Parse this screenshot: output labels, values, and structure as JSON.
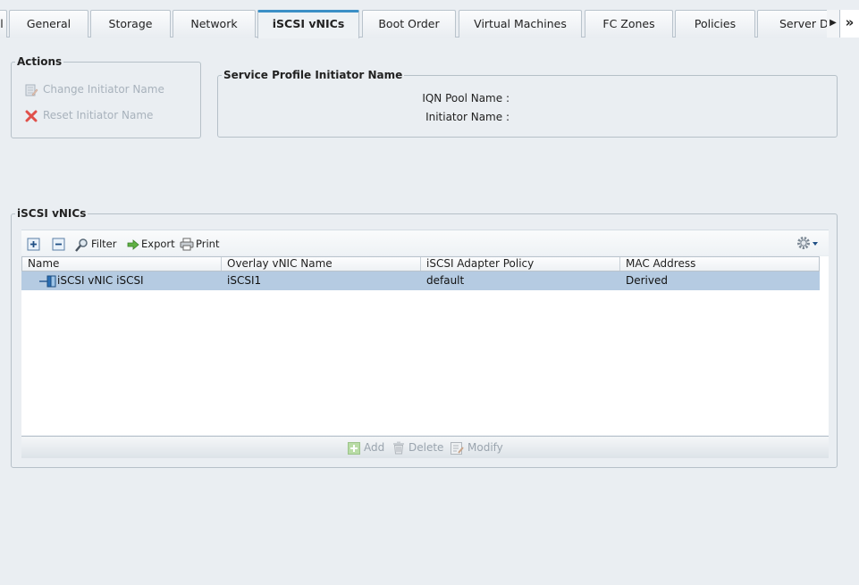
{
  "tabs": [
    {
      "label": "l"
    },
    {
      "label": "General"
    },
    {
      "label": "Storage"
    },
    {
      "label": "Network"
    },
    {
      "label": "iSCSI vNICs"
    },
    {
      "label": "Boot Order"
    },
    {
      "label": "Virtual Machines"
    },
    {
      "label": "FC Zones"
    },
    {
      "label": "Policies"
    },
    {
      "label": "Server De"
    }
  ],
  "active_tab": "iSCSI vNICs",
  "tab_scroll_glyph": "▶",
  "tab_more_glyph": "»",
  "actions": {
    "title": "Actions",
    "items": [
      {
        "label": "Change Initiator Name",
        "icon": "edit-list-icon"
      },
      {
        "label": "Reset Initiator Name",
        "icon": "red-x-icon"
      }
    ]
  },
  "initiator": {
    "title": "Service Profile Initiator Name",
    "iqn_pool_label": "IQN Pool Name :",
    "iqn_pool_value": "",
    "initiator_name_label": "Initiator Name :",
    "initiator_name_value": ""
  },
  "vnics": {
    "title": "iSCSI vNICs",
    "toolbar": {
      "filter": "Filter",
      "export": "Export",
      "print": "Print"
    },
    "columns": [
      "Name",
      "Overlay vNIC Name",
      "iSCSI Adapter Policy",
      "MAC Address"
    ],
    "rows": [
      {
        "name": "iSCSI vNIC iSCSI",
        "overlay": "iSCSI1",
        "policy": "default",
        "mac": "Derived"
      }
    ],
    "footer": {
      "add": "Add",
      "delete": "Delete",
      "modify": "Modify"
    }
  },
  "colors": {
    "accent": "#3a8fc6",
    "selected_row": "#b5cbe2",
    "disabled_text": "#a8b2bc"
  }
}
